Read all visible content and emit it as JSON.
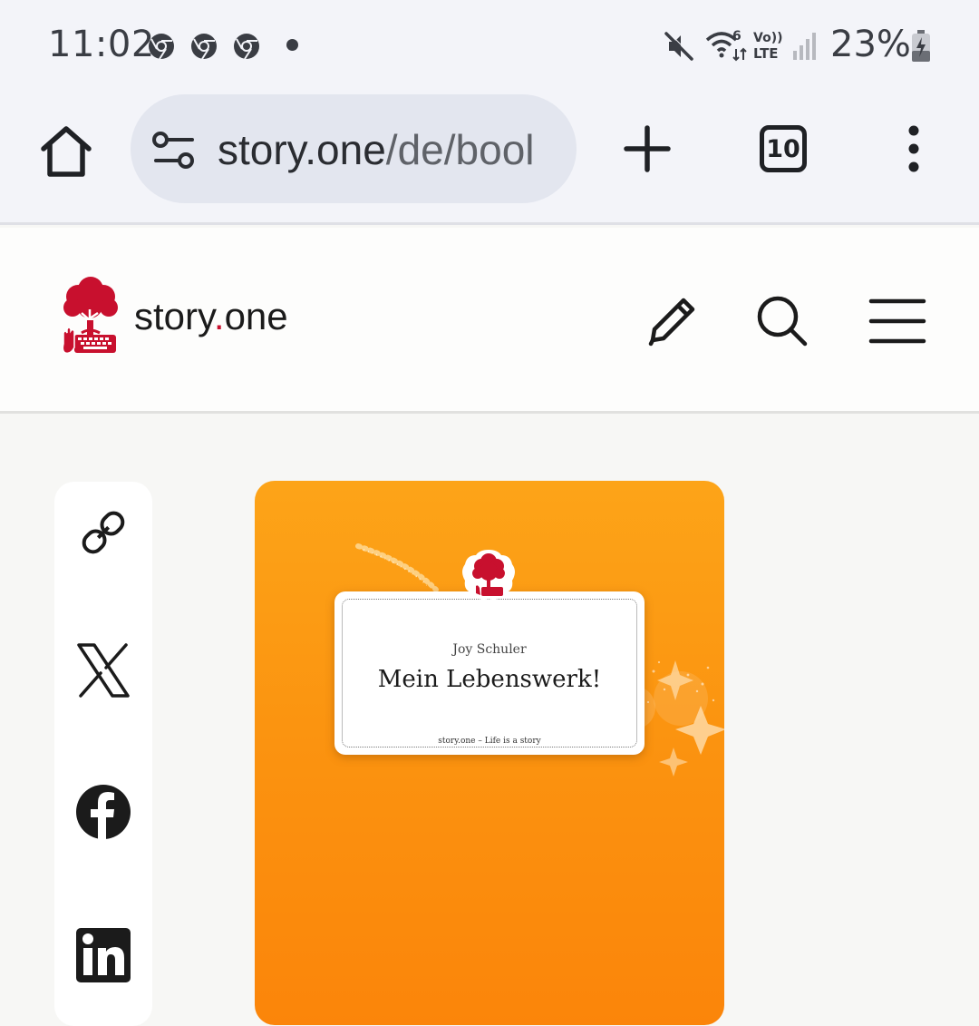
{
  "status_bar": {
    "time": "11:02",
    "battery": "23%",
    "icons": [
      "chrome-icon",
      "chrome-icon",
      "chrome-icon",
      "notification-dot",
      "mute-icon",
      "wifi-6-icon",
      "volte-lte-icon",
      "signal-icon",
      "battery-charging-icon"
    ]
  },
  "browser": {
    "url_main": "story.one",
    "url_rest": "/de/bool",
    "tab_count": "10",
    "icons": [
      "home-icon",
      "site-settings-icon",
      "plus-icon",
      "tabs-icon",
      "more-vert-icon"
    ]
  },
  "site": {
    "logo_name_a": "story",
    "logo_name_dot": ".",
    "logo_name_b": "one",
    "brand_color": "#c8102e",
    "header_icons": [
      "pencil-icon",
      "search-icon",
      "menu-icon"
    ]
  },
  "share": {
    "icons": [
      "link-icon",
      "x-icon",
      "facebook-icon",
      "linkedin-icon"
    ]
  },
  "book": {
    "author": "Joy Schuler",
    "title": "Mein Lebenswerk!",
    "tagline": "story.one – Life is a story",
    "cover_color": "#fb9410"
  }
}
